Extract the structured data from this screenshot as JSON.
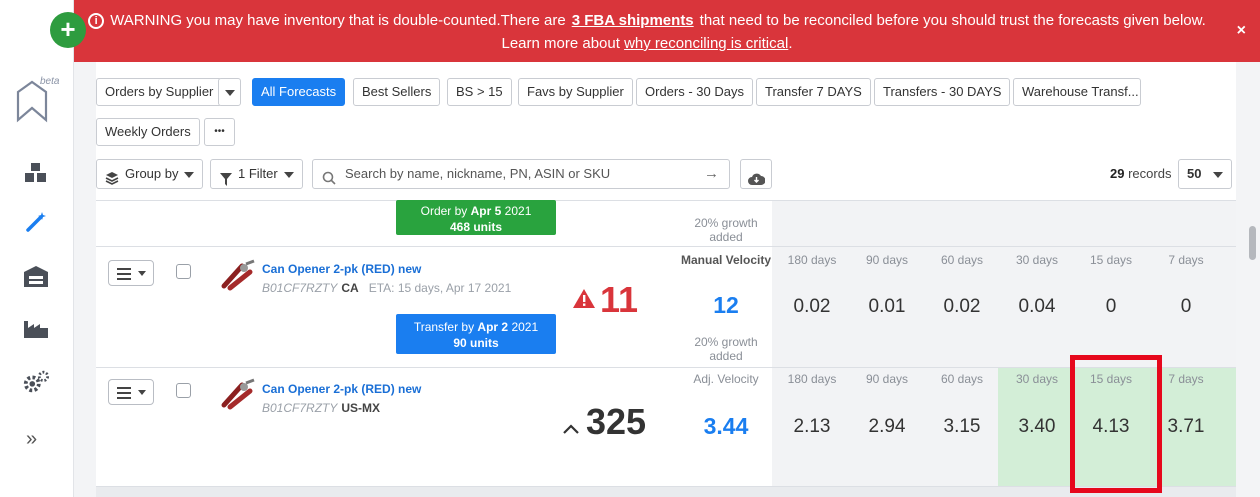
{
  "banner": {
    "text_before": "WARNING you may have inventory that is double-counted.There are",
    "link_shipments": "3 FBA shipments",
    "text_after": "that need to be reconciled before you should trust the forecasts given below.",
    "learn_prefix": "Learn more about",
    "learn_link": "why reconciling is critical",
    "learn_suffix": ".",
    "close": "×"
  },
  "sidebar": {
    "add": "+",
    "beta": "beta",
    "expand": "»",
    "icons": [
      "boxes-icon",
      "magic-wand-icon",
      "warehouse-icon",
      "factory-icon",
      "settings-icon"
    ]
  },
  "toolbar": {
    "views": [
      "Orders by Supplier",
      "All Forecasts",
      "Best Sellers",
      "BS > 15",
      "Favs by Supplier",
      "Orders - 30 Days",
      "Transfer 7 DAYS",
      "Transfers - 30 DAYS",
      "Warehouse Transf..."
    ],
    "weekly": "Weekly Orders",
    "more": "•••",
    "group_by": "Group by",
    "filter": "1 Filter",
    "search_placeholder": "Search by name, nickname, PN, ASIN or SKU",
    "records_count": "29",
    "records_label": "records",
    "page_size": "50"
  },
  "rows": [
    {
      "tag_title_prefix": "Order by",
      "tag_title_date": "Apr 5",
      "tag_title_year": "2021",
      "tag_units": "468 units",
      "growth": "20% growth added"
    },
    {
      "name": "Can Opener 2-pk (RED) new",
      "asin": "B01CF7RZTY",
      "market": "CA",
      "eta": "ETA: 15 days, Apr 17 2021",
      "tag_title_prefix": "Transfer by",
      "tag_title_date": "Apr 2",
      "tag_title_year": "2021",
      "tag_units": "90 units",
      "alert_value": "11",
      "velocity_label": "Manual Velocity",
      "velocity_value": "12",
      "growth": "20% growth added",
      "periods": [
        "180 days",
        "90 days",
        "60 days",
        "30 days",
        "15 days",
        "7 days"
      ],
      "values": [
        "0.02",
        "0.01",
        "0.02",
        "0.04",
        "0",
        "0"
      ]
    },
    {
      "name": "Can Opener 2-pk (RED) new",
      "asin": "B01CF7RZTY",
      "market": "US-MX",
      "trend_value": "325",
      "velocity_label": "Adj. Velocity",
      "velocity_value": "3.44",
      "periods": [
        "180 days",
        "90 days",
        "60 days",
        "30 days",
        "15 days",
        "7 days"
      ],
      "values": [
        "2.13",
        "2.94",
        "3.15",
        "3.40",
        "4.13",
        "3.71"
      ]
    }
  ],
  "colors": {
    "banner": "#d9353b",
    "primary": "#1a7ef0",
    "success": "#29a33e",
    "highlight": "#d3eed7",
    "annotation": "#e6081c"
  }
}
